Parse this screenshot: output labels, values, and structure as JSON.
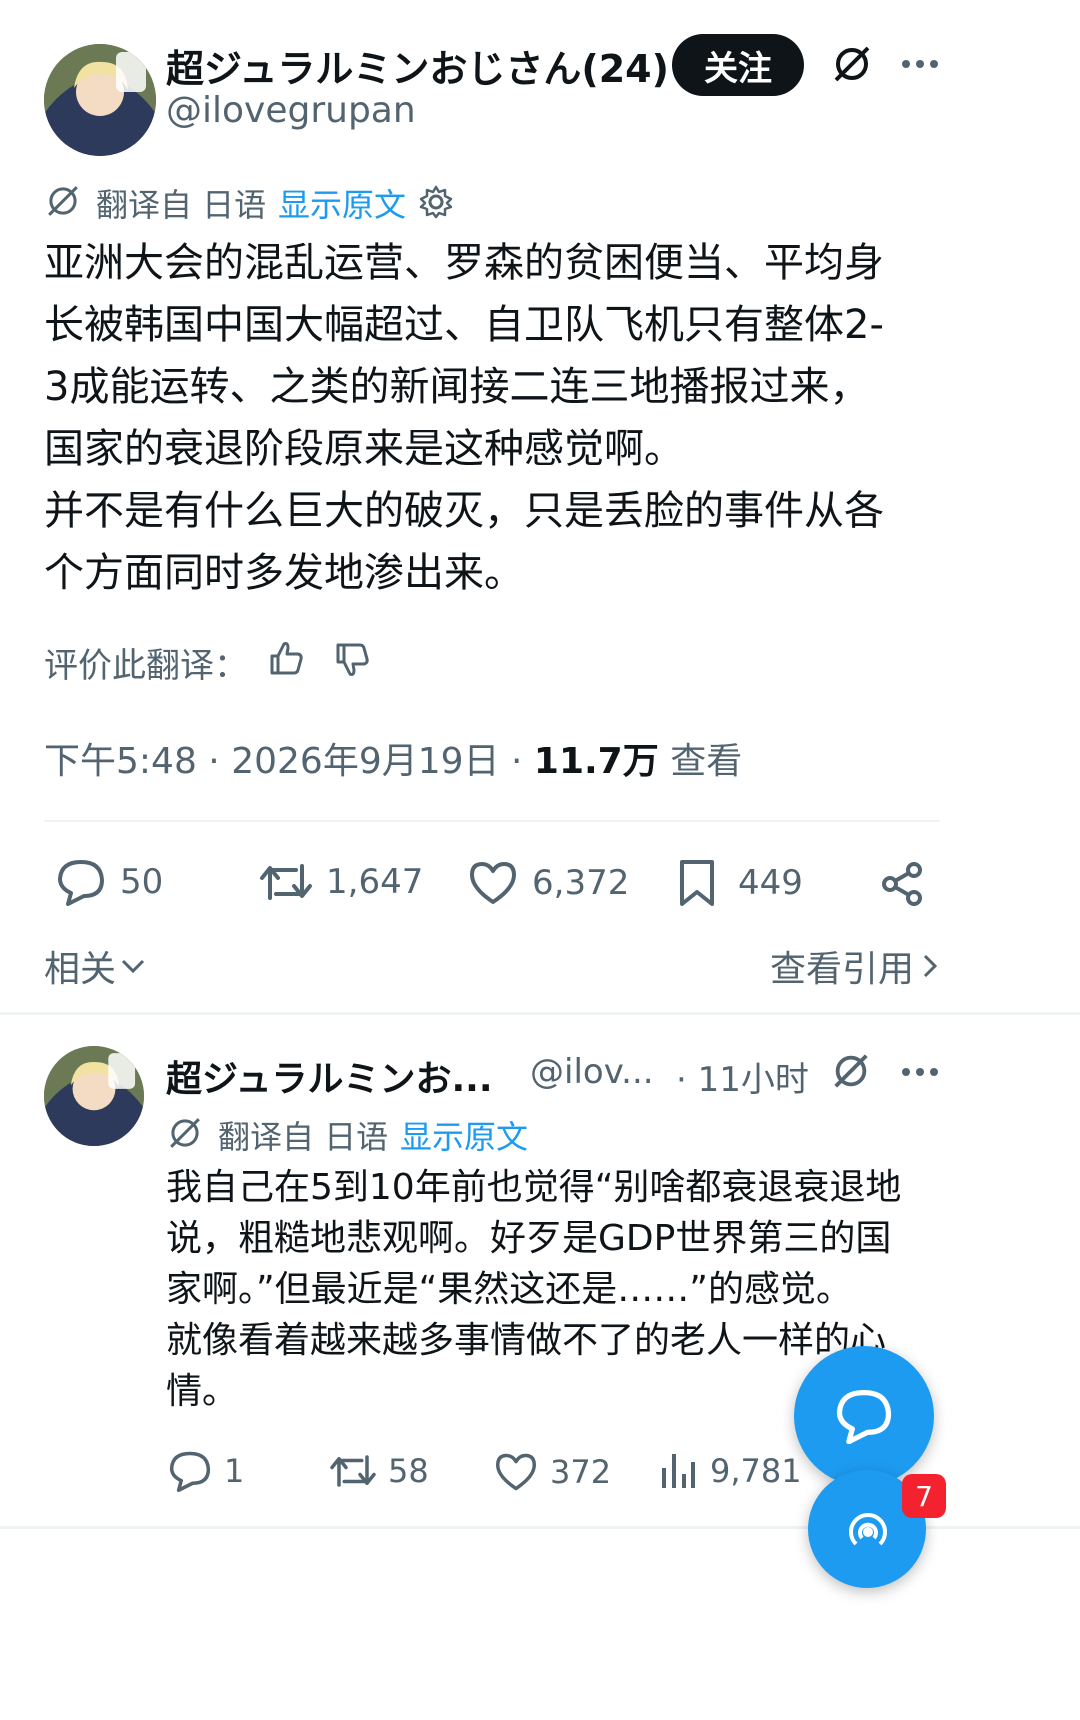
{
  "main_tweet": {
    "author_name": "超ジュラルミンおじさん(24)",
    "handle": "@ilovegrupan",
    "follow_label": "关注",
    "translated_from": "翻译自 日语",
    "show_original": "显示原文",
    "body_lines": [
      "亚洲大会的混乱运营、罗森的贫困便当、平均身",
      "长被韩国中国大幅超过、自卫队飞机只有整体2-",
      "3成能运转、之类的新闻接二连三地播报过来，",
      "国家的衰退阶段原来是这种感觉啊。",
      "并不是有什么巨大的破灭，只是丢脸的事件从各",
      "个方面同时多发地渗出来。"
    ],
    "rate_translation": "评价此翻译：",
    "time": "下午5:48",
    "date": "2026年9月19日",
    "views_count": "11.7万",
    "views_label": "查看",
    "stats": {
      "replies": "50",
      "retweets": "1,647",
      "likes": "6,372",
      "bookmarks": "449"
    },
    "related_label": "相关",
    "view_quotes_label": "查看引用"
  },
  "reply_tweet": {
    "author_name": "超ジュラルミンお...",
    "handle": "@ilov...",
    "time_ago": "· 11小时",
    "translated_from": "翻译自 日语",
    "show_original": "显示原文",
    "body_lines": [
      "我自己在5到10年前也觉得“别啥都衰退衰退地",
      "说，粗糙地悲观啊。好歹是GDP世界第三的国",
      "家啊。”但最近是“果然这还是……”的感觉。",
      "就像看着越来越多事情做不了的老人一样的心",
      "情。"
    ],
    "stats": {
      "replies": "1",
      "retweets": "58",
      "likes": "372",
      "views": "9,781"
    }
  },
  "fab": {
    "badge_count": "7"
  },
  "colors": {
    "text": "#0f1419",
    "secondary": "#536471",
    "accent": "#1d9bf0",
    "badge": "#f4212e"
  }
}
